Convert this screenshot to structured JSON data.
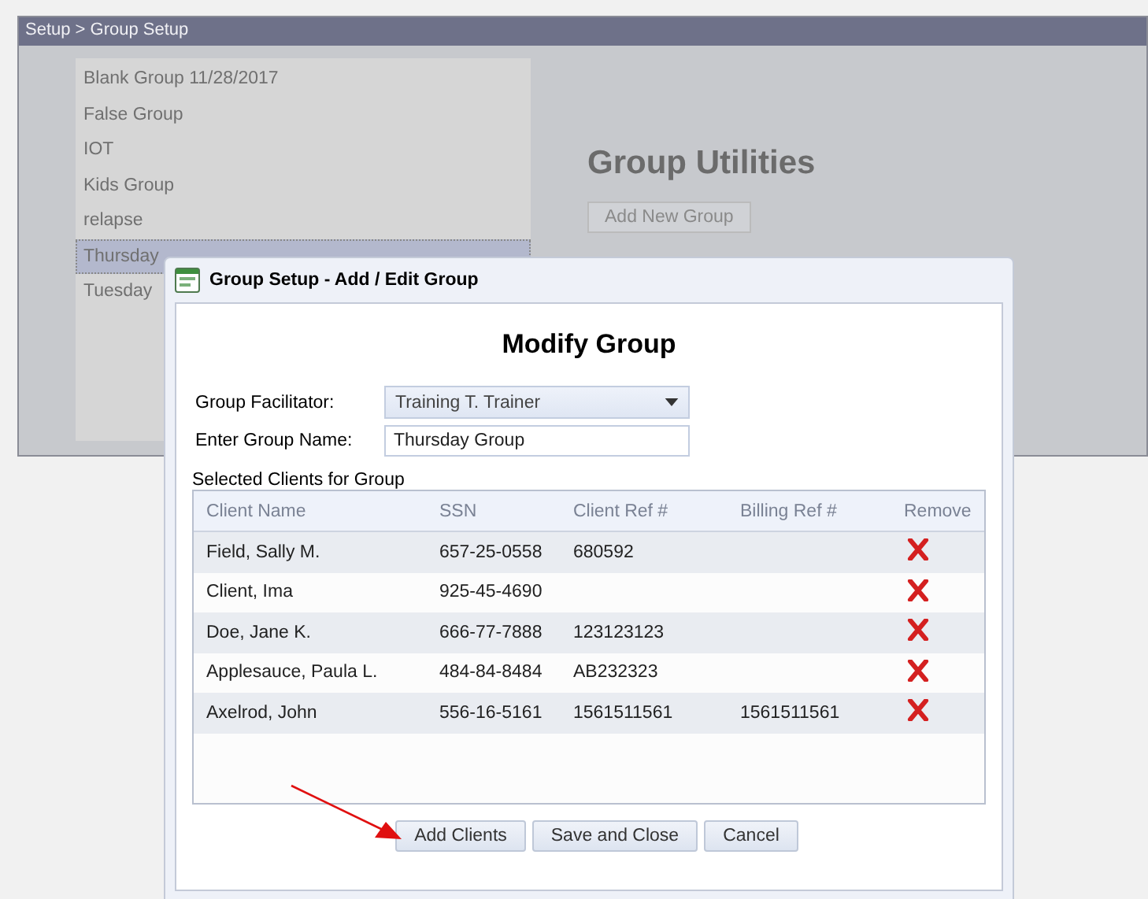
{
  "breadcrumb": "Setup > Group Setup",
  "groups": [
    {
      "label": "Blank Group 11/28/2017",
      "selected": false
    },
    {
      "label": "False Group",
      "selected": false
    },
    {
      "label": "IOT",
      "selected": false
    },
    {
      "label": "Kids Group",
      "selected": false
    },
    {
      "label": "relapse",
      "selected": false
    },
    {
      "label": "Thursday",
      "selected": true
    },
    {
      "label": "Tuesday",
      "selected": false
    }
  ],
  "utilities": {
    "title": "Group Utilities",
    "button": "Add New Group"
  },
  "dialog": {
    "title": "Group Setup - Add / Edit Group",
    "heading": "Modify Group",
    "facilitator_label": "Group Facilitator:",
    "facilitator_value": "Training T. Trainer",
    "name_label": "Enter Group Name:",
    "name_value": "Thursday Group",
    "clients_label": "Selected Clients for Group",
    "table": {
      "columns": [
        "Client Name",
        "SSN",
        "Client Ref #",
        "Billing Ref #",
        "Remove"
      ],
      "rows": [
        [
          "Field, Sally M.",
          "657-25-0558",
          "680592",
          ""
        ],
        [
          "Client, Ima",
          "925-45-4690",
          "",
          ""
        ],
        [
          "Doe, Jane K.",
          "666-77-7888",
          "123123123",
          ""
        ],
        [
          "Applesauce, Paula L.",
          "484-84-8484",
          "AB232323",
          ""
        ],
        [
          "Axelrod, John",
          "556-16-5161",
          "1561511561",
          "1561511561"
        ]
      ]
    },
    "buttons": [
      "Add Clients",
      "Save and Close",
      "Cancel"
    ]
  }
}
